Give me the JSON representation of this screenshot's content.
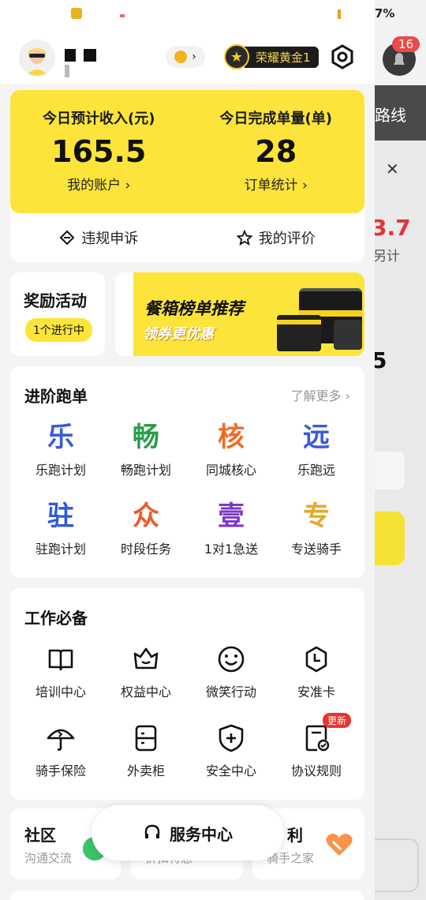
{
  "background_app": {
    "battery": "7%",
    "notification_count": "16",
    "route_text": "路线",
    "amount_fragment": "3.7",
    "extra_text": "另计",
    "count_fragment": "5"
  },
  "header": {
    "rank": "荣耀黄金1"
  },
  "income": {
    "predicted_label": "今日预计收入(元)",
    "predicted_value": "165.5",
    "account_link": "我的账户 ›",
    "orders_label": "今日完成单量(单)",
    "orders_value": "28",
    "order_stats_link": "订单统计 ›",
    "appeal_label": "违规申诉",
    "review_label": "我的评价"
  },
  "rewards": {
    "title": "奖励活动",
    "pill": "1个进行中",
    "banner_title": "餐箱榜单推荐",
    "banner_sub": "领券更优惠"
  },
  "advanced": {
    "title": "进阶跑单",
    "more": "了解更多 ›",
    "items": [
      {
        "glyph": "乐",
        "label": "乐跑计划",
        "color": "#3a5ad9"
      },
      {
        "glyph": "畅",
        "label": "畅跑计划",
        "color": "#2a9c4a"
      },
      {
        "glyph": "核",
        "label": "同城核心",
        "color": "#f06a22"
      },
      {
        "glyph": "远",
        "label": "乐跑远",
        "color": "#3a5ad9"
      },
      {
        "glyph": "驻",
        "label": "驻跑计划",
        "color": "#2f5ad8"
      },
      {
        "glyph": "众",
        "label": "时段任务",
        "color": "#ef5a26"
      },
      {
        "glyph": "壹",
        "label": "1对1急送",
        "color": "#7b39c8"
      },
      {
        "glyph": "专",
        "label": "专送骑手",
        "color": "#e8a82a"
      }
    ]
  },
  "work": {
    "title": "工作必备",
    "items": [
      {
        "icon": "book-icon",
        "label": "培训中心"
      },
      {
        "icon": "crown-icon",
        "label": "权益中心"
      },
      {
        "icon": "smile-icon",
        "label": "微笑行动"
      },
      {
        "icon": "clock-icon",
        "label": "安准卡"
      },
      {
        "icon": "umbrella-icon",
        "label": "骑手保险"
      },
      {
        "icon": "locker-icon",
        "label": "外卖柜"
      },
      {
        "icon": "shield-icon",
        "label": "安全中心"
      },
      {
        "icon": "agreement-icon",
        "label": "协议规则"
      }
    ],
    "new_badge": "更新"
  },
  "bottom": {
    "community_title": "社区",
    "community_sub": "沟通交流",
    "middle_sub": "折扣特惠",
    "welfare_title": "利",
    "welfare_sub": "骑手之家",
    "service_center": "服务中心"
  }
}
